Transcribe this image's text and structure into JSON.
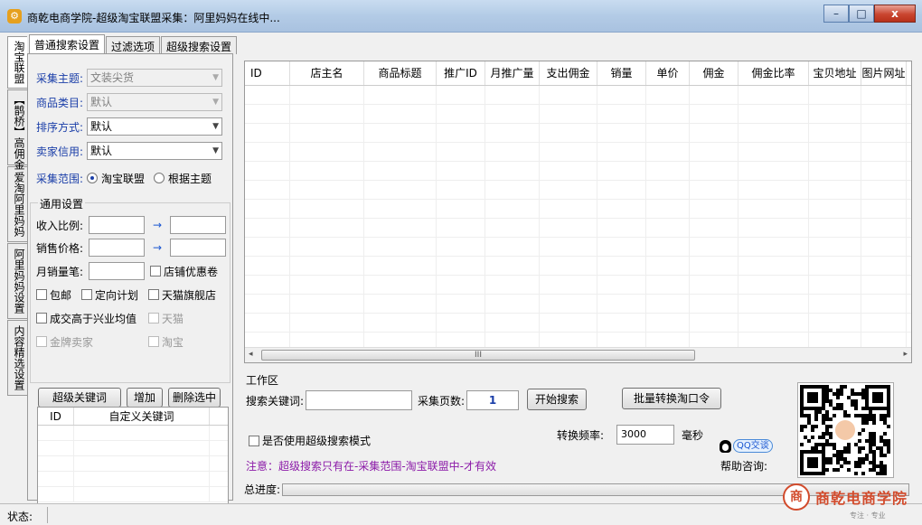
{
  "window": {
    "title": "商乾电商学院-超级淘宝联盟采集：阿里妈妈在线中...",
    "min_glyph": "–",
    "max_glyph": "□",
    "close_glyph": "x"
  },
  "vtabs": [
    "淘宝联盟",
    "【鹊桥】高佣金",
    "爱淘阿里妈妈",
    "阿里妈妈设置",
    "内容精选设置"
  ],
  "htabs": [
    "普通搜索设置",
    "过滤选项",
    "超级搜索设置"
  ],
  "basic": {
    "topic_label": "采集主题:",
    "topic_value": "文装尖货",
    "category_label": "商品类目:",
    "category_value": "默认",
    "sort_label": "排序方式:",
    "sort_value": "默认",
    "credit_label": "卖家信用:",
    "credit_value": "默认",
    "scope_label": "采集范围:",
    "scope_opt1": "淘宝联盟",
    "scope_opt2": "根据主题"
  },
  "general": {
    "title": "通用设置",
    "income_label": "收入比例:",
    "price_label": "销售价格:",
    "monthly_label": "月销量笔:",
    "arrow": "→",
    "chk_coupon": "店铺优惠卷",
    "chk_free_ship": "包邮",
    "chk_plan": "定向计划",
    "chk_tmall_flagship": "天猫旗舰店",
    "chk_above_avg": "成交高于兴业均值",
    "chk_tmall": "天猫",
    "chk_gold": "金牌卖家",
    "chk_taobao": "淘宝"
  },
  "keyword_buttons": {
    "super": "超级关键词",
    "add": "增加",
    "delete": "删除选中"
  },
  "keyword_table": {
    "headers": [
      "ID",
      "自定义关键词"
    ]
  },
  "results": {
    "headers": [
      "ID",
      "店主名",
      "商品标题",
      "推广ID",
      "月推广量",
      "支出佣金",
      "销量",
      "单价",
      "佣金",
      "佣金比率",
      "宝贝地址",
      "图片网址"
    ],
    "scroll_grip": "III",
    "scroll_left": "◂",
    "scroll_right": "▸"
  },
  "work": {
    "title": "工作区",
    "keyword_label": "搜索关键词:",
    "pages_label": "采集页数:",
    "pages_value": "1",
    "start_button": "开始搜索",
    "batch_button": "批量转换淘口令",
    "freq_label": "转换频率:",
    "freq_value": "3000",
    "freq_unit": "毫秒",
    "super_mode_label": "是否使用超级搜索模式",
    "qq_label": "QQ交谈",
    "help_label": "帮助咨询:",
    "notice": "注意：超级搜索只有在-采集范围-淘宝联盟中-才有效",
    "progress_label": "总进度:"
  },
  "status": {
    "label": "状态:"
  },
  "brand": {
    "logo_text": "商乾电商学院",
    "logo_mark": "商",
    "logo_sub": "专注 · 专业"
  },
  "colors": {
    "label_blue": "#1a3ea8",
    "notice_purple": "#8b1aa8",
    "brand_red": "#d24b2c"
  }
}
